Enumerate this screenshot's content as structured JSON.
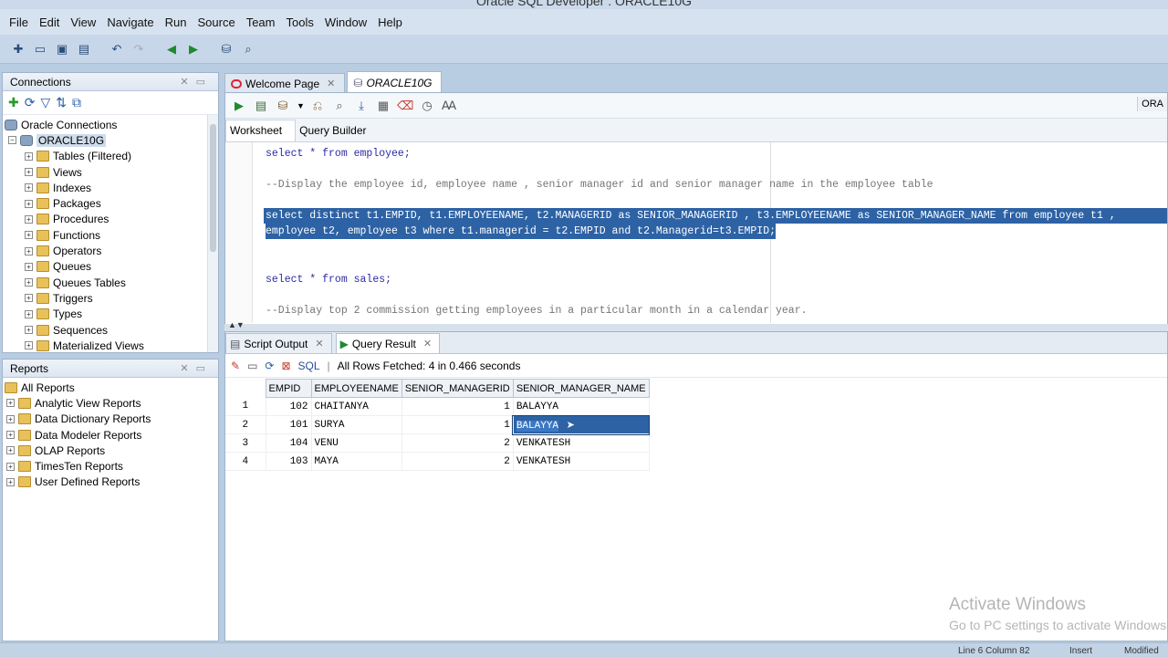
{
  "window": {
    "title": "Oracle SQL Developer : ORACLE10G"
  },
  "menu": [
    "File",
    "Edit",
    "View",
    "Navigate",
    "Run",
    "Source",
    "Team",
    "Tools",
    "Window",
    "Help"
  ],
  "connections": {
    "title": "Connections",
    "root": "Oracle Connections",
    "connection": "ORACLE10G",
    "items": [
      "Tables (Filtered)",
      "Views",
      "Indexes",
      "Packages",
      "Procedures",
      "Functions",
      "Operators",
      "Queues",
      "Queues Tables",
      "Triggers",
      "Types",
      "Sequences",
      "Materialized Views"
    ]
  },
  "reports": {
    "title": "Reports",
    "root": "All Reports",
    "items": [
      "Analytic View Reports",
      "Data Dictionary Reports",
      "Data Modeler Reports",
      "OLAP Reports",
      "TimesTen Reports",
      "User Defined Reports"
    ]
  },
  "tabs": {
    "welcome": "Welcome Page",
    "oracle": "ORACLE10G"
  },
  "editor": {
    "right_label": "ORA",
    "subtabs": [
      "Worksheet",
      "Query Builder"
    ],
    "lines": {
      "l1": "select * from employee;",
      "l2": "--Display the employee id, employee name , senior manager id and senior manager name in the employee table",
      "l3": "select distinct t1.EMPID, t1.EMPLOYEENAME, t2.MANAGERID as SENIOR_MANAGERID , t3.EMPLOYEENAME as SENIOR_MANAGER_NAME from employee t1 ,",
      "l4": "employee t2, employee t3 where t1.managerid = t2.EMPID and t2.Managerid=t3.EMPID;",
      "l5": "select * from sales;",
      "l6": "--Display top 2 commission getting employees in a particular month in a calendar year."
    }
  },
  "results": {
    "tabs": {
      "script": "Script Output",
      "query": "Query Result"
    },
    "sql_label": "SQL",
    "status": "All Rows Fetched: 4 in 0.466 seconds",
    "columns": [
      "EMPID",
      "EMPLOYEENAME",
      "SENIOR_MANAGERID",
      "SENIOR_MANAGER_NAME"
    ],
    "rows": [
      {
        "n": "1",
        "empid": "102",
        "name": "CHAITANYA",
        "mgr": "1",
        "mgrname": "BALAYYA"
      },
      {
        "n": "2",
        "empid": "101",
        "name": "SURYA",
        "mgr": "1",
        "mgrname": "BALAYYA"
      },
      {
        "n": "3",
        "empid": "104",
        "name": "VENU",
        "mgr": "2",
        "mgrname": "VENKATESH"
      },
      {
        "n": "4",
        "empid": "103",
        "name": "MAYA",
        "mgr": "2",
        "mgrname": "VENKATESH"
      }
    ]
  },
  "watermark": {
    "line1": "Activate Windows",
    "line2": "Go to PC settings to activate Windows."
  },
  "status": {
    "position": "Line 6 Column 82",
    "mode": "Insert",
    "modified": "Modified"
  }
}
